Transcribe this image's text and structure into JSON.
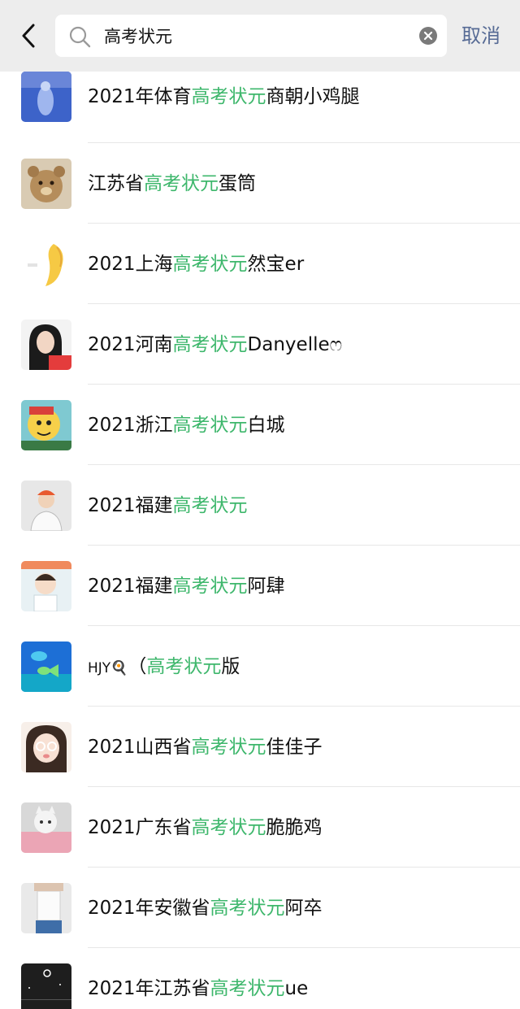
{
  "header": {
    "search_value": "高考状元",
    "cancel_label": "取消",
    "accent_color": "#576b95"
  },
  "highlight_color": "#3eb76c",
  "results": [
    {
      "prefix": "2021年体育",
      "keyword": "高考状元",
      "suffix": "商朝小鸡腿",
      "avatar": "blue-silhouette-avatar"
    },
    {
      "prefix": "江苏省",
      "keyword": "高考状元",
      "suffix": "蛋筒",
      "avatar": "bear-avatar"
    },
    {
      "prefix": "2021上海",
      "keyword": "高考状元",
      "suffix": "然宝er",
      "avatar": "yellow-sketch-avatar"
    },
    {
      "prefix": "2021河南",
      "keyword": "高考状元",
      "suffix": "Danyelleෆ",
      "avatar": "girl-red-shirt-avatar"
    },
    {
      "prefix": "2021浙江",
      "keyword": "高考状元",
      "suffix": "白城",
      "avatar": "cartoon-character-avatar"
    },
    {
      "prefix": "2021福建",
      "keyword": "高考状元",
      "suffix": "",
      "avatar": "person-cap-avatar"
    },
    {
      "prefix": "2021福建",
      "keyword": "高考状元",
      "suffix": "阿肆",
      "avatar": "baby-avatar"
    },
    {
      "prefix": "HJY🍳",
      "keyword": "高考状元",
      "suffix": "版",
      "avatar": "blue-fish-avatar",
      "paren": "（"
    },
    {
      "prefix": "2021山西省",
      "keyword": "高考状元",
      "suffix": "佳佳子",
      "avatar": "girl-glasses-avatar"
    },
    {
      "prefix": "2021广东省",
      "keyword": "高考状元",
      "suffix": "脆脆鸡",
      "avatar": "cat-avatar"
    },
    {
      "prefix": "2021年安徽省",
      "keyword": "高考状元",
      "suffix": "阿卒",
      "avatar": "white-shirt-avatar"
    },
    {
      "prefix": "2021年江苏省",
      "keyword": "高考状元",
      "suffix": "ue",
      "avatar": "dark-sky-avatar"
    }
  ]
}
